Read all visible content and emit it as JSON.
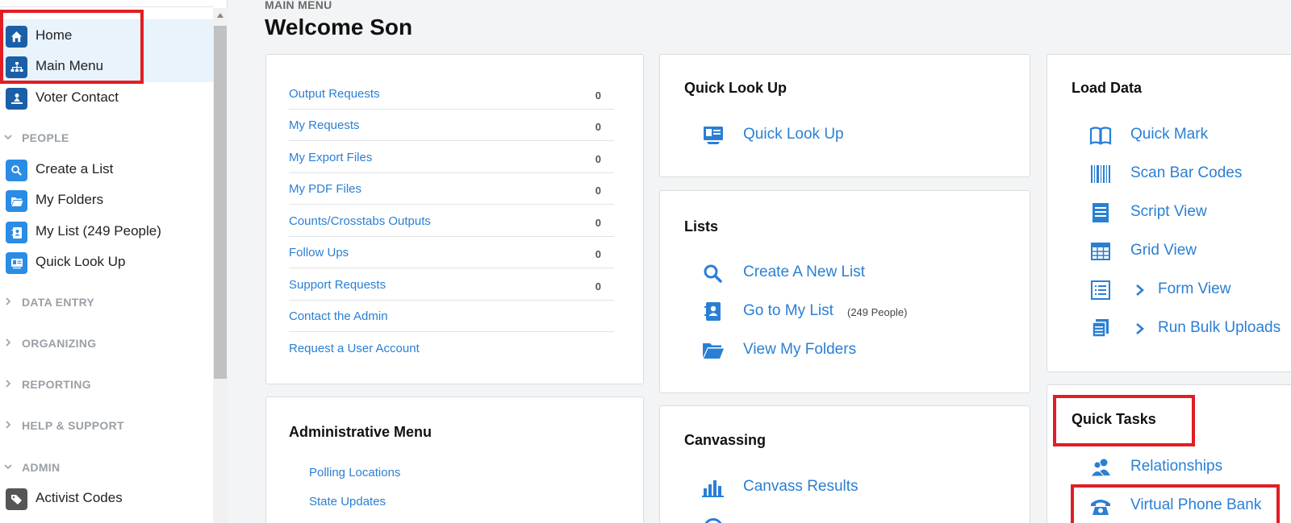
{
  "sidebar": {
    "items_top": [
      {
        "label": "Home",
        "icon": "home-icon"
      },
      {
        "label": "Main Menu",
        "icon": "sitemap-icon"
      },
      {
        "label": "Voter Contact",
        "icon": "voter-contact-icon"
      }
    ],
    "people_section": "PEOPLE",
    "people_items": [
      {
        "label": "Create a List",
        "icon": "search-icon"
      },
      {
        "label": "My Folders",
        "icon": "folder-icon"
      },
      {
        "label": "My List (249 People)",
        "icon": "contact-book-icon"
      },
      {
        "label": "Quick Look Up",
        "icon": "id-card-icon"
      }
    ],
    "sections": [
      "DATA ENTRY",
      "ORGANIZING",
      "REPORTING",
      "HELP & SUPPORT"
    ],
    "admin_section": "ADMIN",
    "admin_items": [
      {
        "label": "Activist Codes",
        "icon": "tags-icon"
      }
    ]
  },
  "header": {
    "breadcrumb": "MAIN MENU",
    "title": "Welcome Son"
  },
  "requests": [
    {
      "label": "Output Requests",
      "count": "0"
    },
    {
      "label": "My Requests",
      "count": "0"
    },
    {
      "label": "My Export Files",
      "count": "0"
    },
    {
      "label": "My PDF Files",
      "count": "0"
    },
    {
      "label": "Counts/Crosstabs Outputs",
      "count": "0"
    },
    {
      "label": "Follow Ups",
      "count": "0"
    },
    {
      "label": "Support Requests",
      "count": "0"
    },
    {
      "label": "Contact the Admin",
      "count": ""
    },
    {
      "label": "Request a User Account",
      "count": ""
    }
  ],
  "admin_menu": {
    "title": "Administrative Menu",
    "links": [
      "Polling Locations",
      "State Updates"
    ]
  },
  "quick_lookup": {
    "title": "Quick Look Up",
    "link": "Quick Look Up"
  },
  "lists": {
    "title": "Lists",
    "links": [
      {
        "label": "Create A New List",
        "sub": ""
      },
      {
        "label": "Go to My List",
        "sub": "(249 People)"
      },
      {
        "label": "View My Folders",
        "sub": ""
      }
    ]
  },
  "canvassing": {
    "title": "Canvassing",
    "links": [
      "Canvass Results"
    ]
  },
  "load_data": {
    "title": "Load Data",
    "links": [
      {
        "label": "Quick Mark",
        "icon": "book-icon"
      },
      {
        "label": "Scan Bar Codes",
        "icon": "barcode-icon"
      },
      {
        "label": "Script View",
        "icon": "script-icon"
      },
      {
        "label": "Grid View",
        "icon": "grid-icon"
      },
      {
        "label": "Form View",
        "icon": "form-icon"
      },
      {
        "label": "Run Bulk Uploads",
        "icon": "bulk-upload-icon"
      }
    ]
  },
  "quick_tasks": {
    "title": "Quick Tasks",
    "links": [
      {
        "label": "Relationships",
        "icon": "people-icon"
      },
      {
        "label": "Virtual Phone Bank",
        "icon": "phone-icon"
      }
    ]
  },
  "colors": {
    "link": "#2a7fd4",
    "accent_dark": "#1b5fa7",
    "highlight_box": "#e01e25",
    "selected_bg": "#e8f3fc"
  }
}
